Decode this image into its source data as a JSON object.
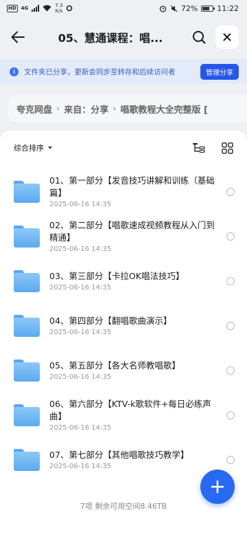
{
  "status_bar": {
    "network_badge": "HD",
    "network_type": "4G",
    "speed_value": "7.3",
    "speed_unit": "K/s",
    "battery_percent": "72%",
    "battery_level": 0.72,
    "time": "11:22"
  },
  "header": {
    "title": "05、慧通课程：唱..."
  },
  "notice": {
    "text": "文件夹已分享，更新会同步至转存和后续访问者",
    "manage_button": "管理分享"
  },
  "breadcrumb": {
    "items": [
      "夸克网盘",
      "来自：分享",
      "唱歌教程大全完整版 ["
    ]
  },
  "toolbar": {
    "sort_label": "综合排序"
  },
  "files": [
    {
      "name": "01、第一部分【发音技巧讲解和训练（基础篇】",
      "date": "2025-06-16 14:35"
    },
    {
      "name": "02、第二部分【唱歌速成视频教程从入门到精通】",
      "date": "2025-06-16 14:35"
    },
    {
      "name": "03、第三部分【卡拉OK唱法技巧】",
      "date": "2025-06-16 14:35"
    },
    {
      "name": "04、第四部分【翻唱歌曲演示】",
      "date": "2025-06-16 14:35"
    },
    {
      "name": "05、第五部分【各大名师教唱歌】",
      "date": "2025-06-16 14:35"
    },
    {
      "name": "06、第六部分【KTV-k歌软件+每日必练声曲】",
      "date": "2025-06-16 14:35"
    },
    {
      "name": "07、第七部分【其他唱歌技巧教学】",
      "date": "2025-06-16 14:35"
    }
  ],
  "footer": {
    "summary": "7项 剩余可用空间8.46TB"
  },
  "colors": {
    "accent": "#2769f0",
    "folder": "#5ba9ef",
    "notice_bg": "#e3ebfa"
  }
}
